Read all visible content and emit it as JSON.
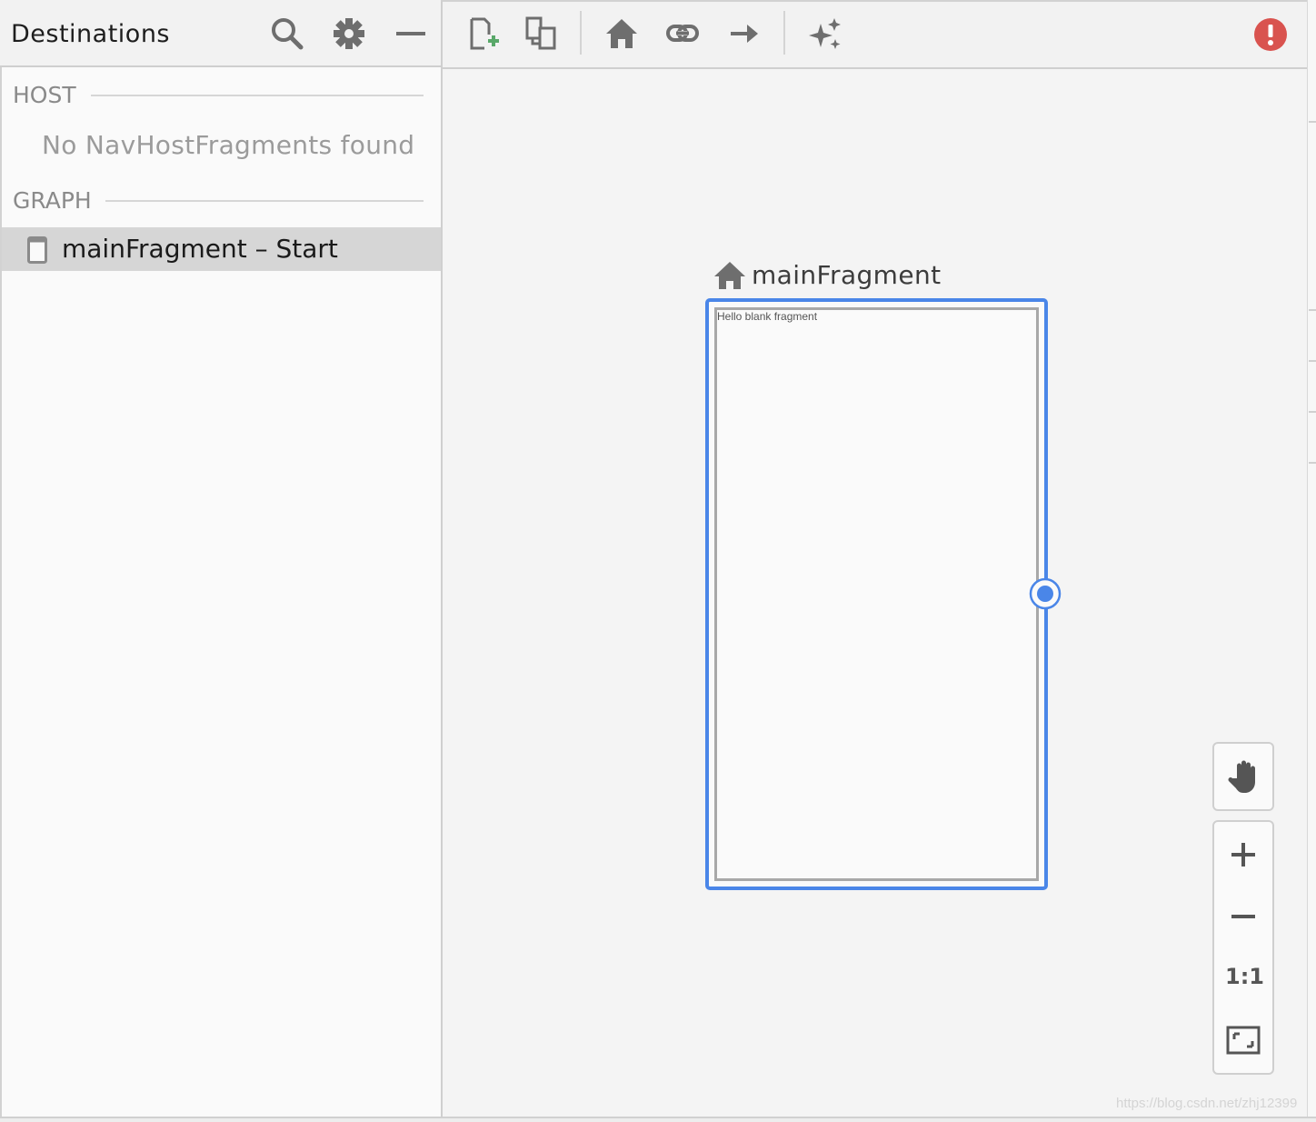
{
  "destinations_panel": {
    "title": "Destinations",
    "host_section": {
      "label": "HOST",
      "empty_message": "No NavHostFragments found"
    },
    "graph_section": {
      "label": "GRAPH",
      "items": [
        {
          "label": "mainFragment – Start",
          "icon": "fragment-screen-icon",
          "selected": true
        }
      ]
    },
    "header_icons": [
      "search-icon",
      "gear-icon",
      "minimize-icon"
    ]
  },
  "toolbar": {
    "icons": [
      "new-destination-icon",
      "nested-graph-icon",
      "home-icon",
      "deep-link-icon",
      "action-arrow-icon",
      "auto-arrange-icon"
    ],
    "status_icon": "error-icon"
  },
  "canvas": {
    "fragment": {
      "name": "mainFragment",
      "preview_text": "Hello blank fragment",
      "is_start": true
    }
  },
  "zoom_controls": {
    "icons": [
      "pan-hand-icon",
      "zoom-in-icon",
      "zoom-out-icon",
      "zoom-to-fit-icon"
    ],
    "actual_size_label": "1:1"
  },
  "watermark": "https://blog.csdn.net/zhj12399",
  "colors": {
    "accent": "#4a86e8",
    "error": "#d9534f",
    "add_green": "#59a869",
    "icon_gray": "#6e6e6e"
  }
}
